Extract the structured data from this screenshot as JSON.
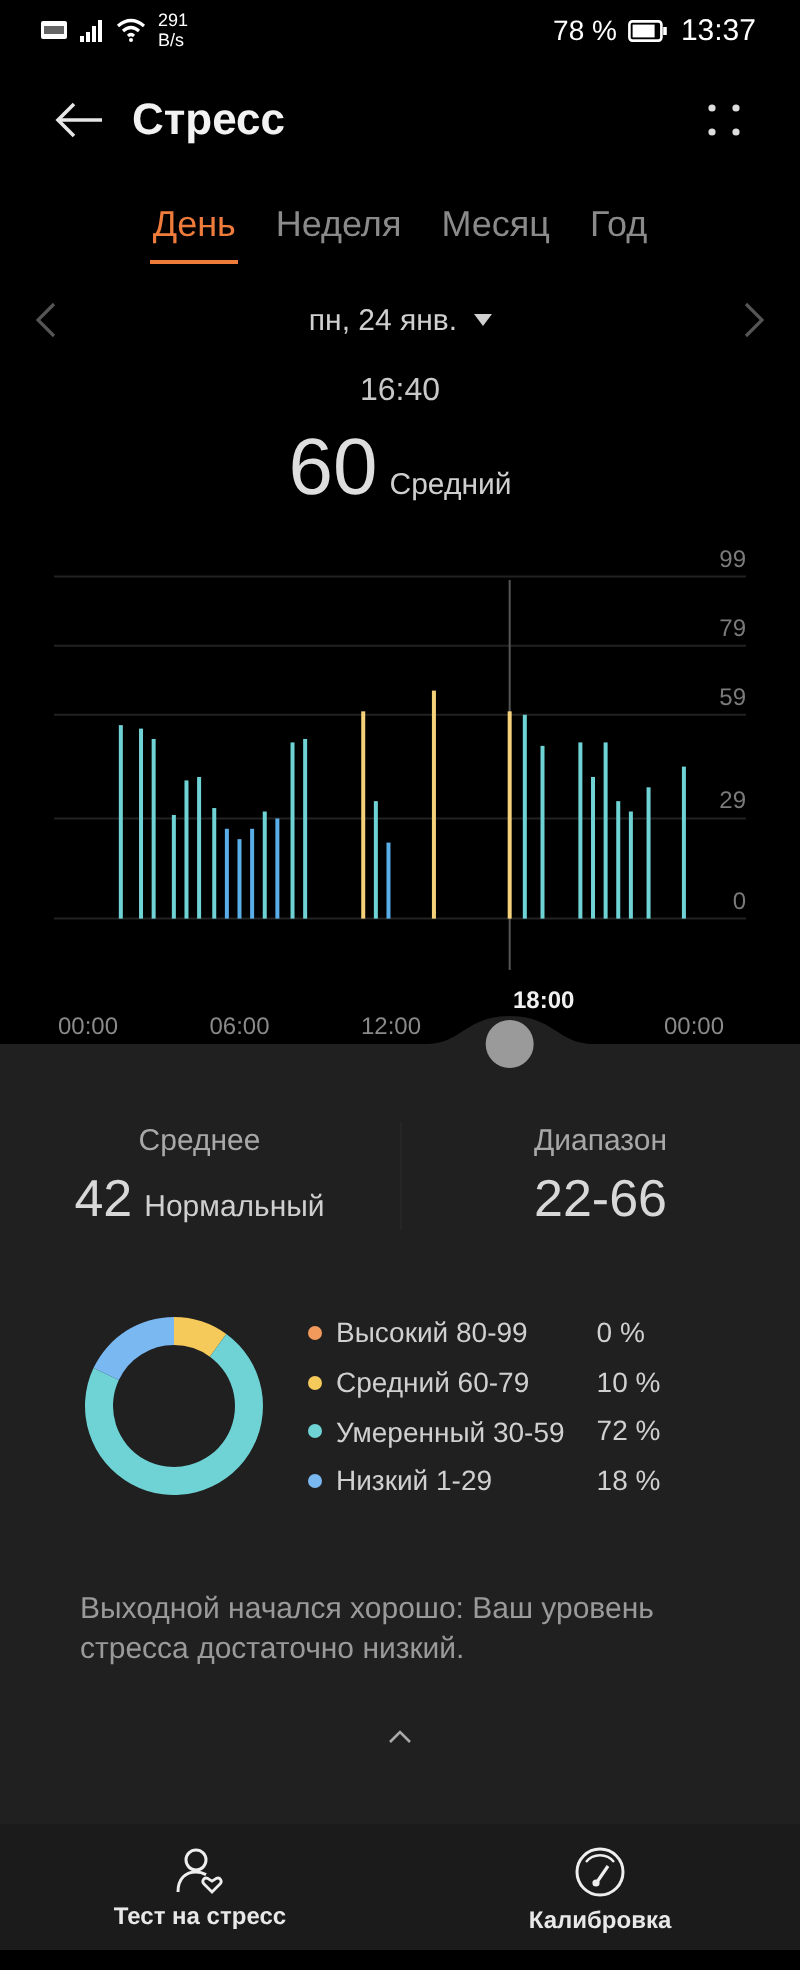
{
  "status_bar": {
    "network_speed": "291",
    "speed_unit": "B/s",
    "battery": "78 %",
    "time": "13:37"
  },
  "header": {
    "title": "Стресс"
  },
  "tabs": [
    {
      "label": "День",
      "selected": true
    },
    {
      "label": "Неделя",
      "selected": false
    },
    {
      "label": "Месяц",
      "selected": false
    },
    {
      "label": "Год",
      "selected": false
    }
  ],
  "date": {
    "label": "пн, 24 янв."
  },
  "reading": {
    "time": "16:40",
    "value": "60",
    "level_label": "Средний"
  },
  "chart": {
    "chart_data": {
      "type": "bar",
      "x": [
        1.3,
        2.1,
        2.6,
        3.4,
        3.9,
        4.4,
        5.0,
        5.5,
        6.0,
        6.5,
        7.0,
        7.5,
        8.1,
        8.6,
        10.9,
        11.4,
        11.9,
        13.7,
        16.7,
        17.3,
        18.0,
        19.5,
        20.0,
        20.5,
        21.0,
        21.5,
        22.2,
        23.6
      ],
      "series": [
        {
          "color": "#6fd3d6",
          "values": [
            56,
            55,
            52,
            30,
            40,
            41,
            32,
            null,
            null,
            null,
            31,
            null,
            51,
            52,
            null,
            34,
            null,
            null,
            null,
            59,
            50,
            51,
            41,
            51,
            34,
            31,
            38,
            44
          ]
        },
        {
          "color": "#5aaee8",
          "values": [
            null,
            null,
            null,
            null,
            null,
            null,
            null,
            26,
            23,
            26,
            null,
            29,
            null,
            null,
            null,
            null,
            22,
            null,
            null,
            null,
            null,
            null,
            null,
            null,
            null,
            null,
            null,
            null
          ]
        },
        {
          "color": "#f5d27a",
          "values": [
            null,
            null,
            null,
            null,
            null,
            null,
            null,
            null,
            null,
            null,
            null,
            null,
            null,
            null,
            60,
            null,
            null,
            66,
            60,
            null,
            null,
            null,
            null,
            null,
            null,
            null,
            null,
            null
          ]
        }
      ],
      "xlim": [
        0,
        24
      ],
      "ylim": [
        0,
        99
      ],
      "xticks": [
        {
          "value": 0,
          "label": "00:00"
        },
        {
          "value": 6,
          "label": "06:00"
        },
        {
          "value": 12,
          "label": "12:00"
        },
        {
          "value": 24,
          "label": "00:00"
        }
      ],
      "yticks": [
        0,
        29,
        59,
        79,
        99
      ],
      "grid": true,
      "ref_lines": [
        {
          "axis": "x",
          "value": 16.7
        }
      ],
      "annotations": [
        "18:00"
      ]
    }
  },
  "summary": {
    "average": {
      "label": "Среднее",
      "value": "42",
      "rating": "Нормальный"
    },
    "range": {
      "label": "Диапазон",
      "value": "22-66"
    }
  },
  "distribution": {
    "chart_data": {
      "type": "donut",
      "values": [
        0,
        10,
        72,
        18
      ]
    },
    "legend": [
      {
        "label": "Высокий 80-99",
        "percent": "0 %",
        "color": "#f29a5c"
      },
      {
        "label": "Средний 60-79",
        "percent": "10 %",
        "color": "#f5c95a"
      },
      {
        "label": "Умеренный 30-59",
        "percent": "72 %",
        "color": "#6fd3d6"
      },
      {
        "label": "Низкий 1-29",
        "percent": "18 %",
        "color": "#7ab8f2"
      }
    ]
  },
  "message": "Выходной начался хорошо: Ваш уровень стресса достаточно низкий.",
  "actions": [
    {
      "label": "Тест на стресс",
      "kind": "test"
    },
    {
      "label": "Калибровка",
      "kind": "calibrate"
    }
  ]
}
